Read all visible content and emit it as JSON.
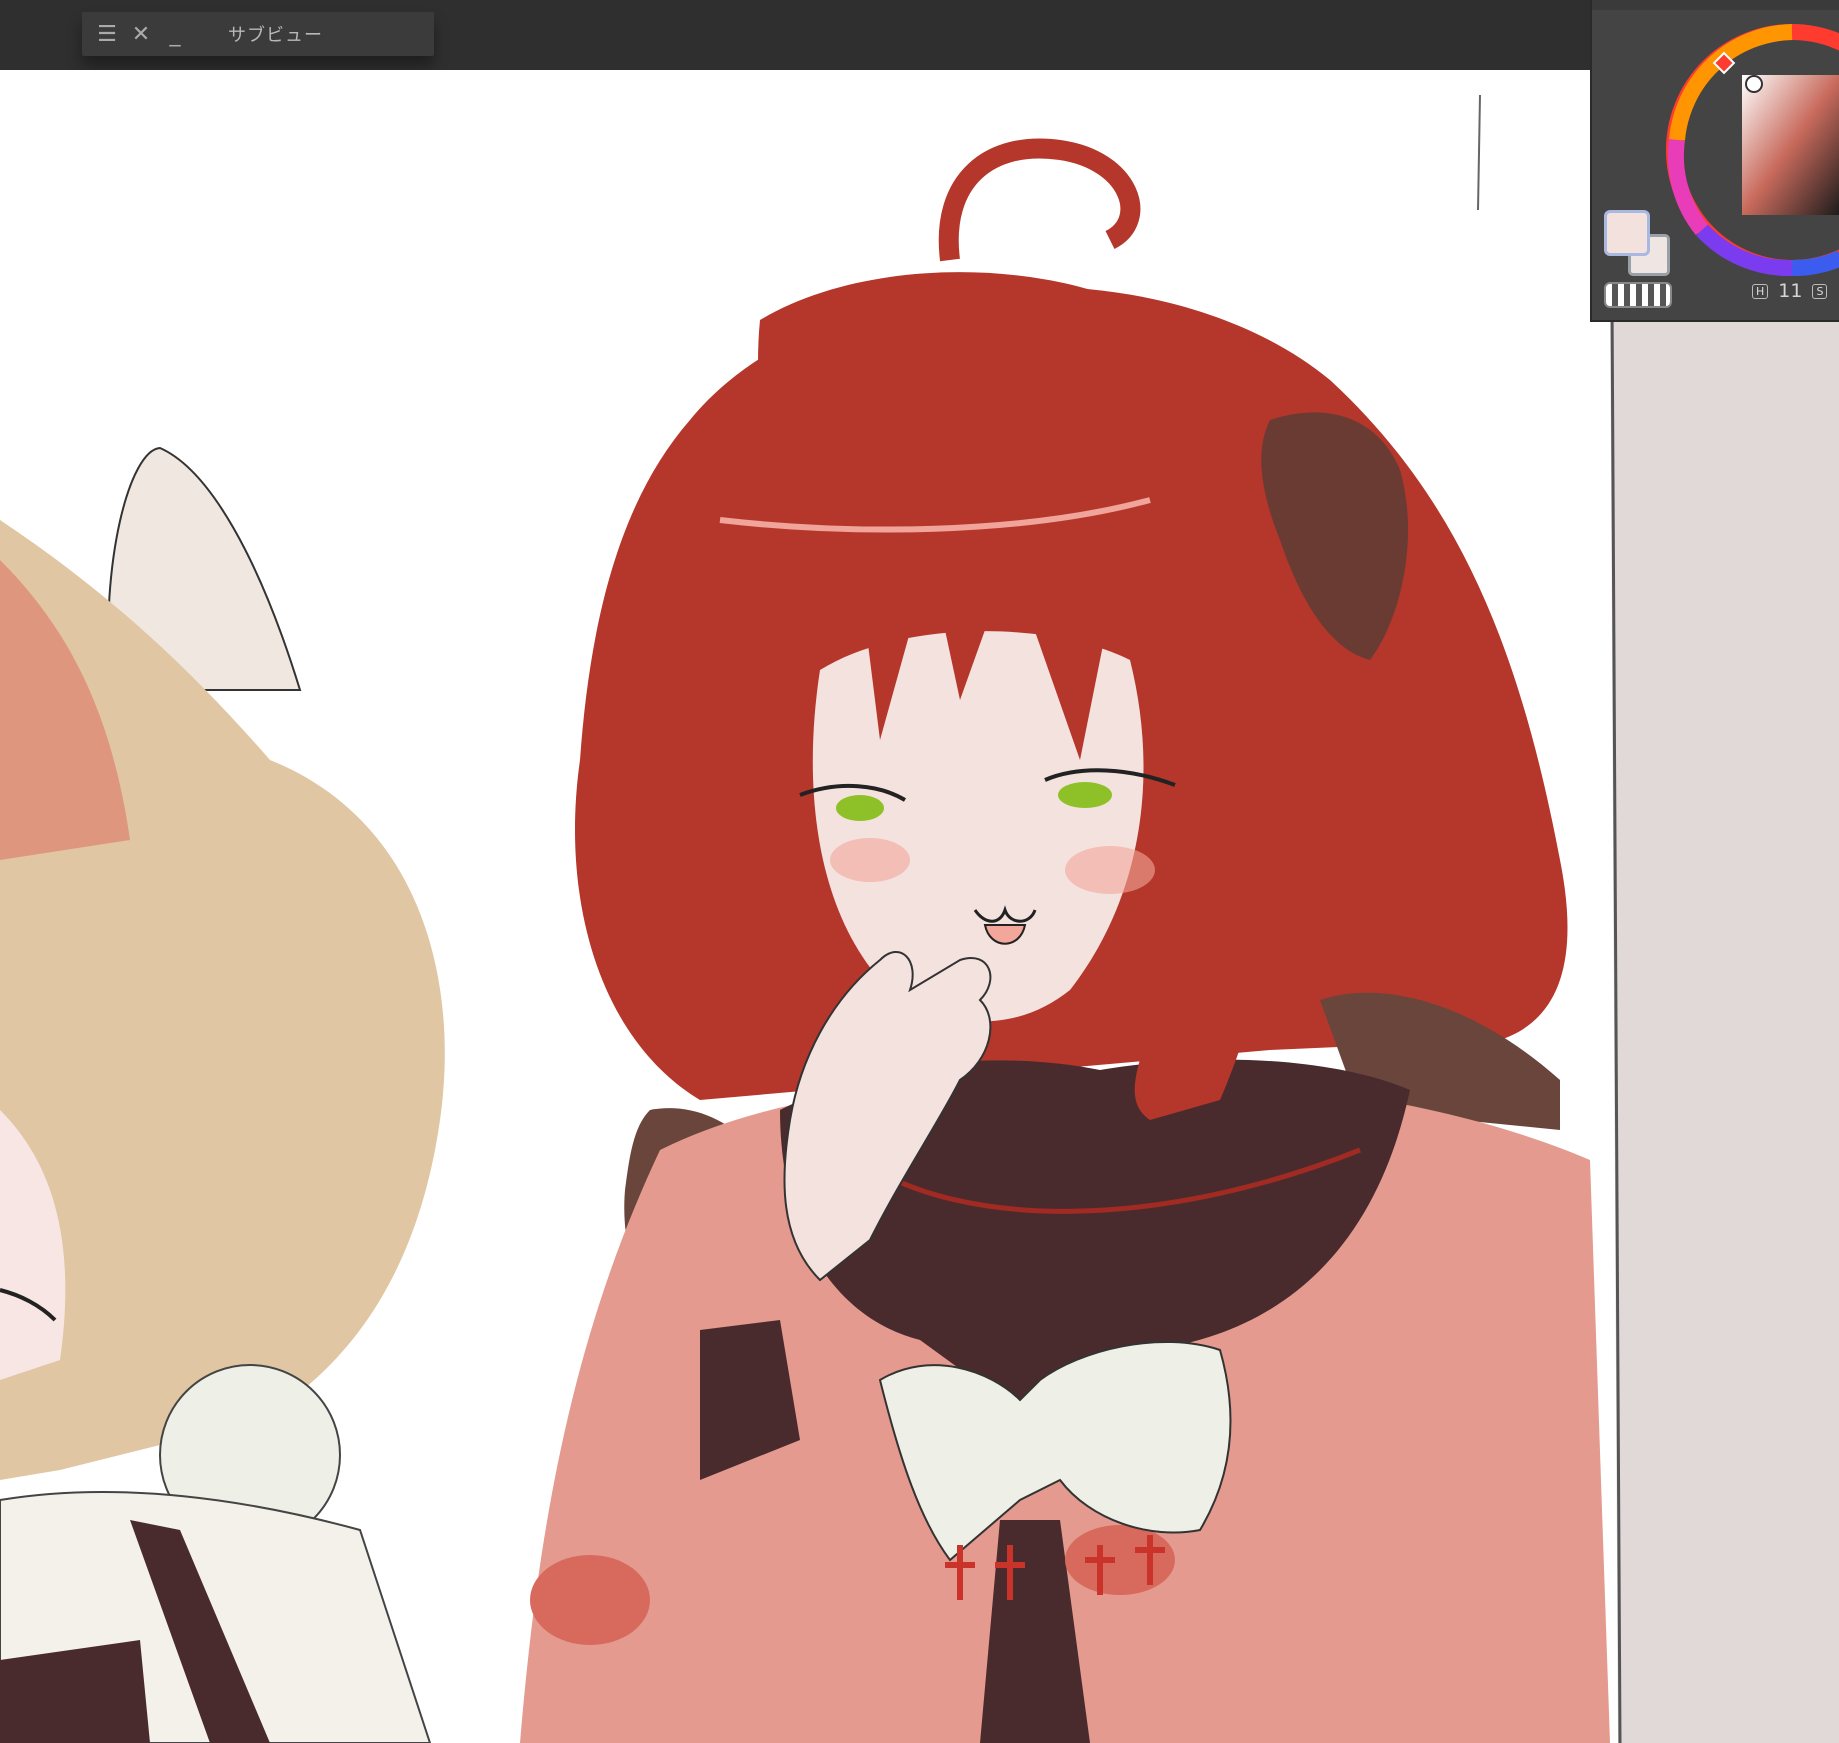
{
  "subview_window": {
    "title": "サブビュー",
    "menu_icon": "hamburger-icon",
    "close_icon": "close-icon",
    "minimize_icon": "minimize-icon"
  },
  "color_panel": {
    "hue_label": "H",
    "hue_value": "11",
    "saturation_label": "S",
    "main_color": "#f2e1dd",
    "sub_color": "#efe5e2"
  },
  "canvas": {
    "hair_color": "#b5372b",
    "skin_color": "#f4e2df",
    "uniform_color": "#e49a8e",
    "collar_color": "#4a2b2d",
    "bow_color": "#eeefe6",
    "blonde_hair_color": "#e0c6a2",
    "eye_color": "#8ec128",
    "wall_color": "#e1d8d8"
  }
}
